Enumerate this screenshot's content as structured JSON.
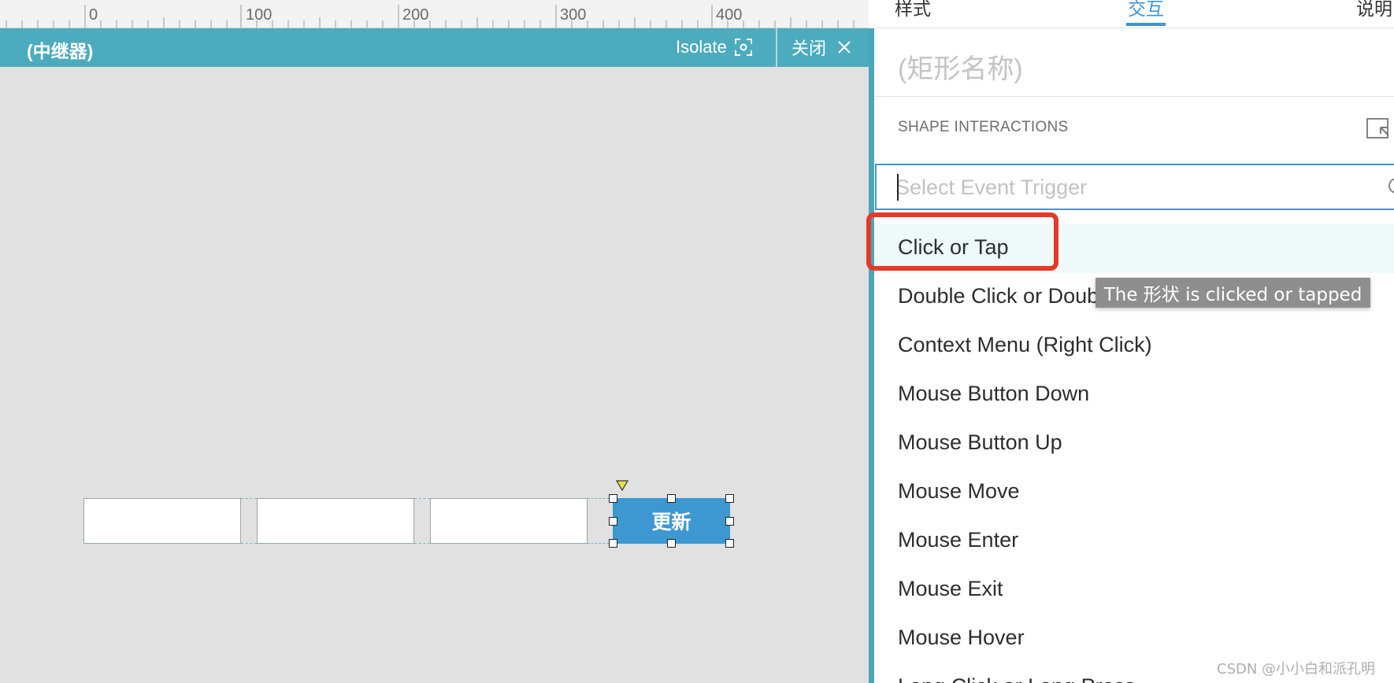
{
  "ruler": {
    "labels": [
      "0",
      "100",
      "200",
      "300",
      "400"
    ]
  },
  "repeater_bar": {
    "title": "(中继器)",
    "isolate_label": "Isolate",
    "close_label": "关闭"
  },
  "canvas": {
    "update_button_label": "更新"
  },
  "panel": {
    "tabs": [
      {
        "label": "样式",
        "active": false
      },
      {
        "label": "交互",
        "active": true
      },
      {
        "label": "说明",
        "active": false
      }
    ],
    "shape_name_placeholder": "(矩形名称)",
    "section_title": "SHAPE INTERACTIONS",
    "trigger_placeholder": "Select Event Trigger",
    "menu_items": [
      "Click or Tap",
      "Double Click or Double Tap",
      "Context Menu (Right Click)",
      "Mouse Button Down",
      "Mouse Button Up",
      "Mouse Move",
      "Mouse Enter",
      "Mouse Exit",
      "Mouse Hover",
      "Long Click or Long Press"
    ]
  },
  "tooltip": "The 形状 is clicked or tapped",
  "watermark": "CSDN @小小白和派孔明",
  "colors": {
    "accent": "#3c94d8",
    "repeater_bar": "#4cacbd",
    "highlight": "#e63a28",
    "button": "#3d97d0"
  }
}
